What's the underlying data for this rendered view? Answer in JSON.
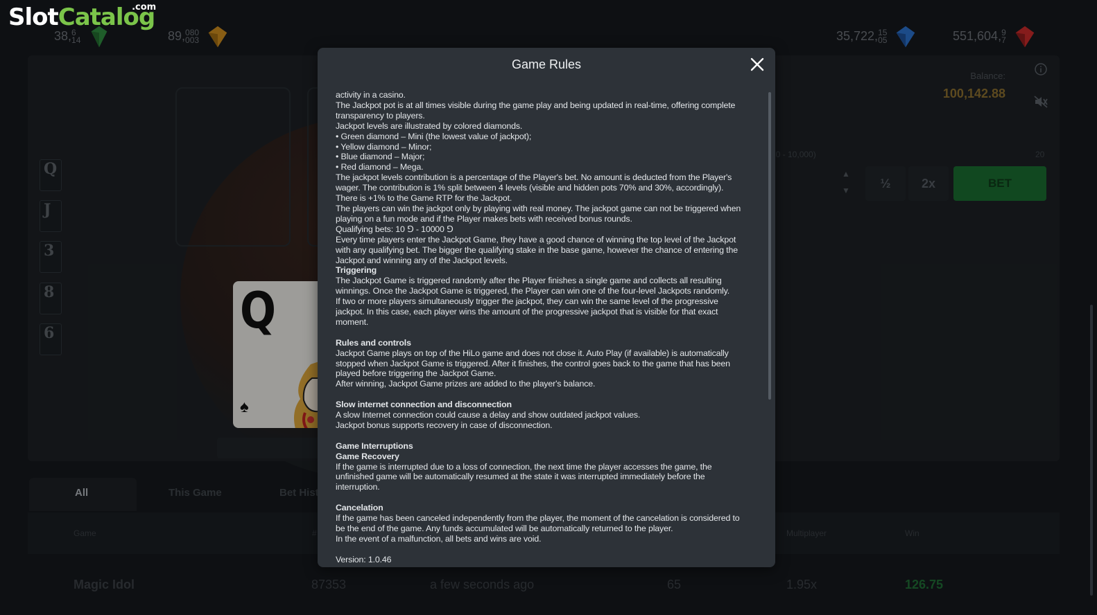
{
  "brand": {
    "slot": "Slot",
    "catalog": "Catalog",
    "com": ".com"
  },
  "jackpots": [
    {
      "id": "mini",
      "value": "38,",
      "frac_top": "6",
      "frac_bottom": "14",
      "gem": "green-diamond-icon",
      "color": "#2e8a3e"
    },
    {
      "id": "minor",
      "value": "89,",
      "frac_top": "080",
      "frac_bottom": "003",
      "gem": "yellow-diamond-icon",
      "color": "#c98a1e"
    },
    {
      "id": "major",
      "value": "35,722,",
      "frac_top": "15",
      "frac_bottom": "05",
      "gem": "blue-diamond-icon",
      "color": "#2a6fc9"
    },
    {
      "id": "mega",
      "value": "551,604,",
      "frac_top": "9",
      "frac_bottom": "7",
      "gem": "red-diamond-icon",
      "color": "#c42a2a"
    }
  ],
  "balance": {
    "label": "Balance:",
    "value": "100,142.88"
  },
  "bet": {
    "range_label": "(10 - 10,000)",
    "max_label": "20",
    "half_label": "½",
    "double_label": "2x",
    "bet_label": "BET"
  },
  "history_cards": [
    "Q",
    "J",
    "3",
    "8",
    "6"
  ],
  "current_card": {
    "rank": "Q",
    "suit": "♠"
  },
  "tabs": [
    "All",
    "This Game",
    "Bet Hist"
  ],
  "table": {
    "headers": {
      "game": "Game",
      "hash": "#",
      "multiplayer": "Multiplayer",
      "win": "Win"
    },
    "row": {
      "game": "Magic Idol",
      "id": "87353",
      "time": "a few seconds ago",
      "bet": "65",
      "multiplier": "1.95x",
      "win": "126.75"
    }
  },
  "modal": {
    "title": "Game Rules",
    "lines": [
      {
        "t": "activity in a casino."
      },
      {
        "t": "The Jackpot pot is at all times visible during the game play and being updated in real-time, offering complete"
      },
      {
        "t": "transparency to players."
      },
      {
        "t": "Jackpot levels are illustrated by colored diamonds."
      },
      {
        "t": "• Green diamond – Mini (the lowest value of jackpot);"
      },
      {
        "t": "• Yellow diamond – Minor;"
      },
      {
        "t": "• Blue diamond – Major;"
      },
      {
        "t": "• Red diamond – Mega."
      },
      {
        "t": "The jackpot levels contribution is a percentage of the Player's bet. No amount is deducted from the Player's"
      },
      {
        "t": "wager. The contribution is 1% split between 4 levels (visible and hidden pots 70% and 30%, accordingly)."
      },
      {
        "t": "There is +1% to the Game RTP for the Jackpot."
      },
      {
        "t": "The players can win the jackpot only by playing with real money. The jackpot game can not be triggered when"
      },
      {
        "t": "playing on a fun mode and if the Player makes bets with received bonus rounds."
      },
      {
        "t": "Qualifying bets: 10 ⅁ - 10000 ⅁"
      },
      {
        "t": "Every time players enter the Jackpot Game, they have a good chance of winning the top level of the Jackpot"
      },
      {
        "t": "with any qualifying bet. The bigger the qualifying stake in the base game, however the chance of entering the"
      },
      {
        "t": "Jackpot and winning any of the Jackpot levels."
      },
      {
        "t": "Triggering",
        "h": true
      },
      {
        "t": "The Jackpot Game is triggered randomly after the Player finishes a single game and collects all resulting"
      },
      {
        "t": "winnings. Once the Jackpot Game is triggered, the Player can win one of the four-level Jackpots randomly."
      },
      {
        "t": "If two or more players simultaneously trigger the jackpot, they can win the same level of the progressive"
      },
      {
        "t": "jackpot. In this case, each player wins the amount of the progressive jackpot that is visible for that exact"
      },
      {
        "t": "moment."
      },
      {
        "t": ""
      },
      {
        "t": "Rules and controls",
        "h": true
      },
      {
        "t": "Jackpot Game plays on top of the HiLo game and does not close it. Auto Play (if available) is automatically"
      },
      {
        "t": "stopped when Jackpot Game is triggered. After it finishes, the control goes back to the game that has been"
      },
      {
        "t": "played before triggering the Jackpot Game."
      },
      {
        "t": "After winning, Jackpot Game prizes are added to the player's balance."
      },
      {
        "t": ""
      },
      {
        "t": "Slow internet connection and disconnection",
        "h": true
      },
      {
        "t": "A slow Internet connection could cause a delay and show outdated jackpot values."
      },
      {
        "t": "Jackpot bonus supports recovery in case of disconnection."
      },
      {
        "t": ""
      },
      {
        "t": "Game Interruptions",
        "h": true
      },
      {
        "t": "Game Recovery",
        "h": true
      },
      {
        "t": "If the game is interrupted due to a loss of connection, the next time the player accesses the game, the"
      },
      {
        "t": "unfinished game will be automatically resumed at the state it was interrupted immediately before the"
      },
      {
        "t": "interruption."
      },
      {
        "t": ""
      },
      {
        "t": "Cancelation",
        "h": true
      },
      {
        "t": "If the game has been canceled independently from the player, the moment of the cancelation is considered to"
      },
      {
        "t": "be the end of the game. Any funds accumulated will be automatically returned to the player."
      },
      {
        "t": "In the event of a malfunction, all bets and wins are void."
      },
      {
        "t": ""
      },
      {
        "t": "Version: 1.0.46"
      }
    ]
  }
}
